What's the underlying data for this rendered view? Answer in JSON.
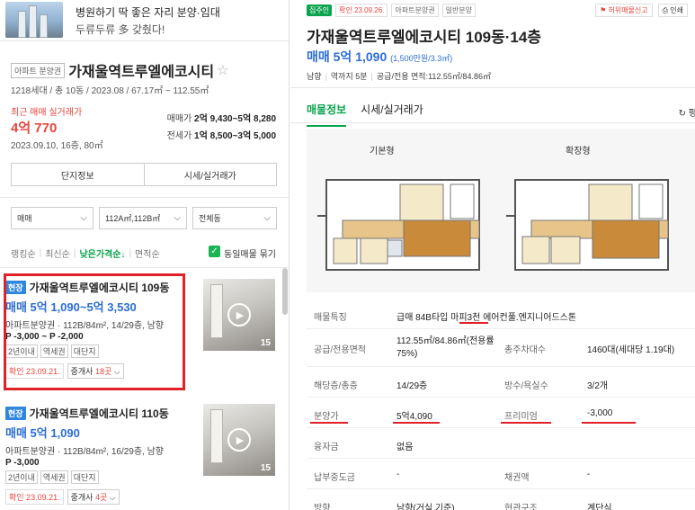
{
  "ad": {
    "line1": "병원하기 딱 좋은 자리 분양·임대",
    "line2": "두류두류 多 갖췄다!"
  },
  "complex": {
    "tag": "아파트 분양권",
    "name": "가재울역트루엘에코시티",
    "star": "☆",
    "info": "1218세대 / 총 10동 / 2023.08 / 67.17㎡ ~ 112.55㎡",
    "recent_label": "최근 매매 실거래가",
    "recent_price": "4억 770",
    "recent_date": "2023.09.10, 16층, 80㎡",
    "sale_label": "매매가",
    "sale_range": "2억 9,430~5억 8,280",
    "jeonse_label": "전세가",
    "jeonse_range": "1억 8,500~3억 5,000",
    "btn_info": "단지정보",
    "btn_price": "시세/실거래가"
  },
  "filters": {
    "trade": "매매",
    "area": "112A㎡,112B㎡",
    "dong": "전체동"
  },
  "sorts": {
    "s1": "랭킹순",
    "s2": "최신순",
    "s3": "낮은가격순↓",
    "s4": "면적순",
    "same_listing": "동일매물 묶기"
  },
  "listings": [
    {
      "badge": "현장",
      "title": "가재울역트루엘에코시티 109동",
      "price": "매매 5억 1,090~5억 3,530",
      "spec": "아파트분양권 · 112B/84m², 14/29층, 남향",
      "premium": "P -3,000 ~ P -2,000",
      "tags": [
        "2년이내",
        "역세권",
        "대단지"
      ],
      "confirmed": "확인 23.09.21.",
      "agent_prefix": "중개사 ",
      "agent_count": "18곳",
      "agent_suffix": " ⌵",
      "photo_count": "15"
    },
    {
      "badge": "현장",
      "title": "가재울역트루엘에코시티 110동",
      "price": "매매 5억 1,090",
      "spec": "아파트분양권 · 112B/84m², 16/29층, 남향",
      "premium": "P -3,000",
      "tags": [
        "2년이내",
        "역세권",
        "대단지"
      ],
      "confirmed": "확인 23.09.21.",
      "agent_prefix": "중개사 ",
      "agent_count": "4곳",
      "agent_suffix": " ⌵",
      "photo_count": "15"
    }
  ],
  "detail": {
    "badge_confirm": "집주인",
    "badge_date": "확인 23.09.26.",
    "badge_type1": "아파트분양권",
    "badge_type2": "일반분양",
    "report": "허위매물신고",
    "print": "인쇄",
    "title": "가재울역트루엘에코시티 109동·14층",
    "price": "매매 5억 1,090",
    "price_sub": "(1,500만원/3.3㎡)",
    "spec_dir": "남향",
    "spec_station": "역까지 5분",
    "spec_area": "공급/전용 면적:112.55㎡/84.86㎡",
    "tab_info": "매물정보",
    "tab_price": "시세/실거래가",
    "refresh": "↻ 평",
    "plan_basic": "기본형",
    "plan_extended": "확장형",
    "rows": {
      "feature_k": "매물특징",
      "feature_v": "급매 84B타입 마피3천 에어컨풀.엔지니어드스톤",
      "area_k": "공급/전용면적",
      "area_v": "112.55㎡/84.86㎡(전용률75%)",
      "households_k": "총주차대수",
      "households_v": "1460대(세대당 1.19대)",
      "floor_k": "해당층/총층",
      "floor_v": "14/29층",
      "rooms_k": "방수/욕실수",
      "rooms_v": "3/2개",
      "presale_k": "분양가",
      "presale_v": "5억4,090",
      "premium_k": "프리미엄",
      "premium_v": "-3,000",
      "loan_k": "융자금",
      "loan_v": "없음",
      "mid_k": "납부중도금",
      "mid_v": "-",
      "bond_k": "채권액",
      "bond_v": "-",
      "dir_k": "방향",
      "dir_v": "남향(거실 기준)",
      "struct_k": "현관구조",
      "struct_v": "계단식"
    }
  },
  "colors": {
    "accent_green": "#0aa44c",
    "price_blue": "#2c6dd1",
    "alert_red": "#e7453b",
    "highlight_red": "#e1212a"
  }
}
